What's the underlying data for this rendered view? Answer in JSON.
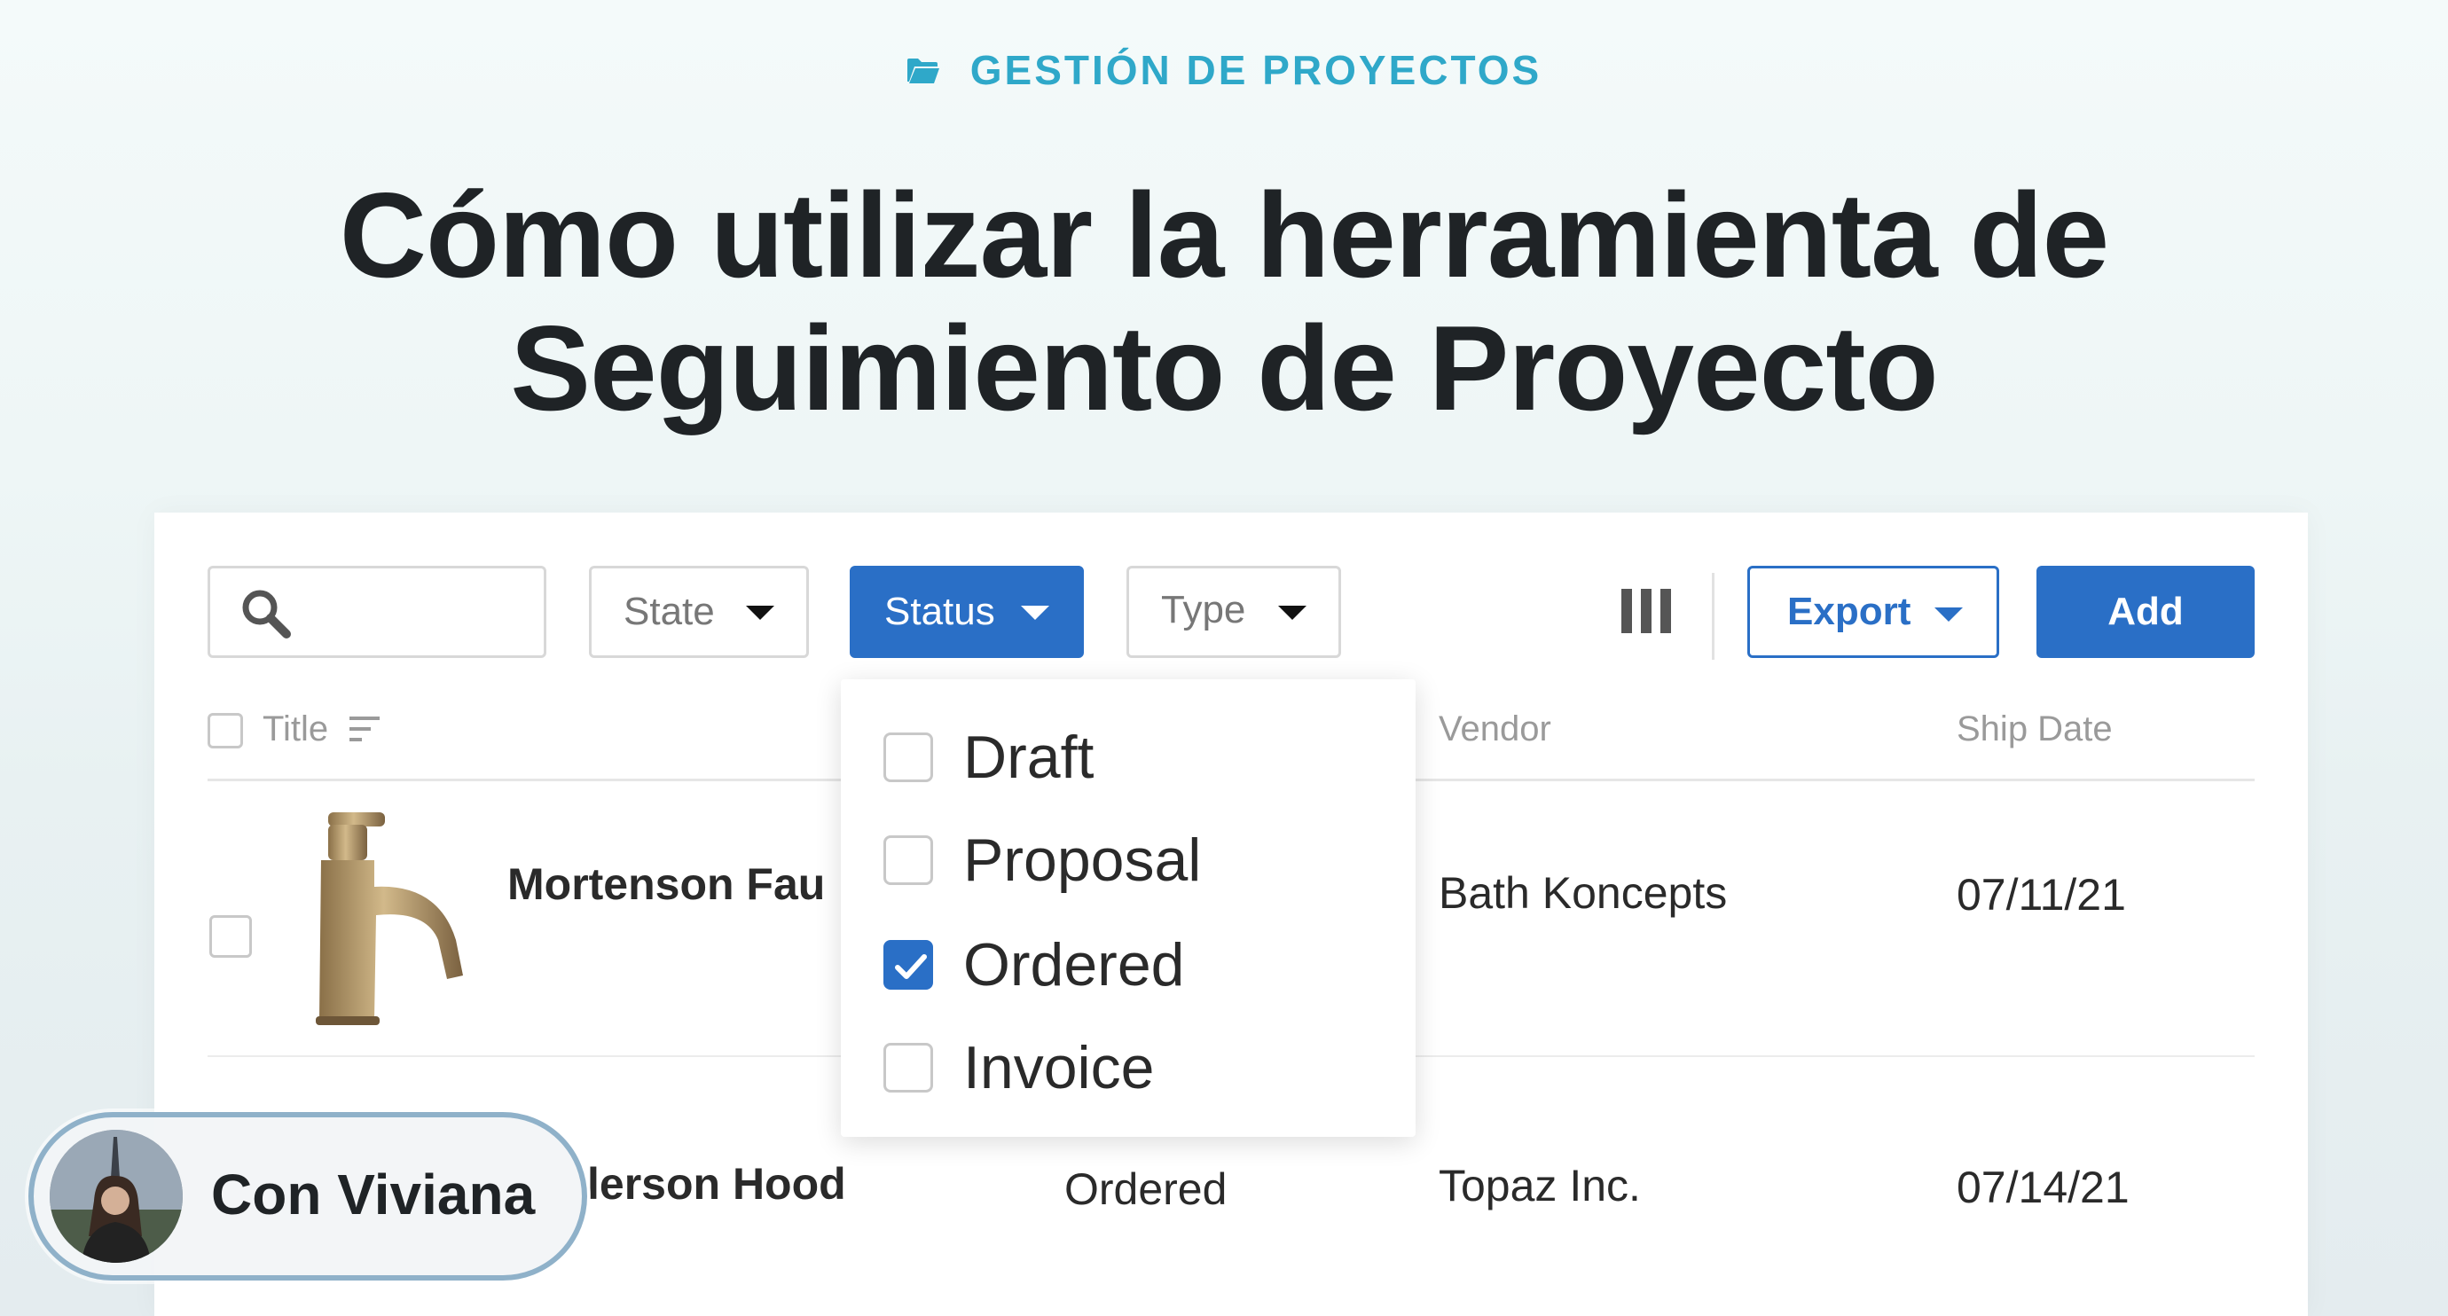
{
  "header": {
    "category": "GESTIÓN DE PROYECTOS",
    "category_icon": "folder-icon",
    "title_line1": "Cómo utilizar la herramienta de",
    "title_line2": "Seguimiento de Proyecto"
  },
  "toolbar": {
    "search_placeholder": "",
    "state_label": "State",
    "status_label": "Status",
    "type_label": "Type",
    "export_label": "Export",
    "add_label": "Add"
  },
  "table": {
    "columns": {
      "title": "Title",
      "vendor": "Vendor",
      "ship_date": "Ship Date"
    },
    "rows": [
      {
        "title": "Mortenson Fau",
        "status": "",
        "vendor": "Bath Koncepts",
        "ship_date": "07/11/21"
      },
      {
        "title": "lerson Hood",
        "status": "Ordered",
        "vendor": "Topaz Inc.",
        "ship_date": "07/14/21"
      }
    ]
  },
  "status_menu": {
    "options": [
      {
        "label": "Draft",
        "checked": false
      },
      {
        "label": "Proposal",
        "checked": false
      },
      {
        "label": "Ordered",
        "checked": true
      },
      {
        "label": "Invoice",
        "checked": false
      }
    ]
  },
  "presenter": {
    "name": "Con Viviana"
  },
  "colors": {
    "accent_blue": "#2a6fc6",
    "eyebrow_teal": "#2fa8c9",
    "title_dark": "#1f2326"
  }
}
